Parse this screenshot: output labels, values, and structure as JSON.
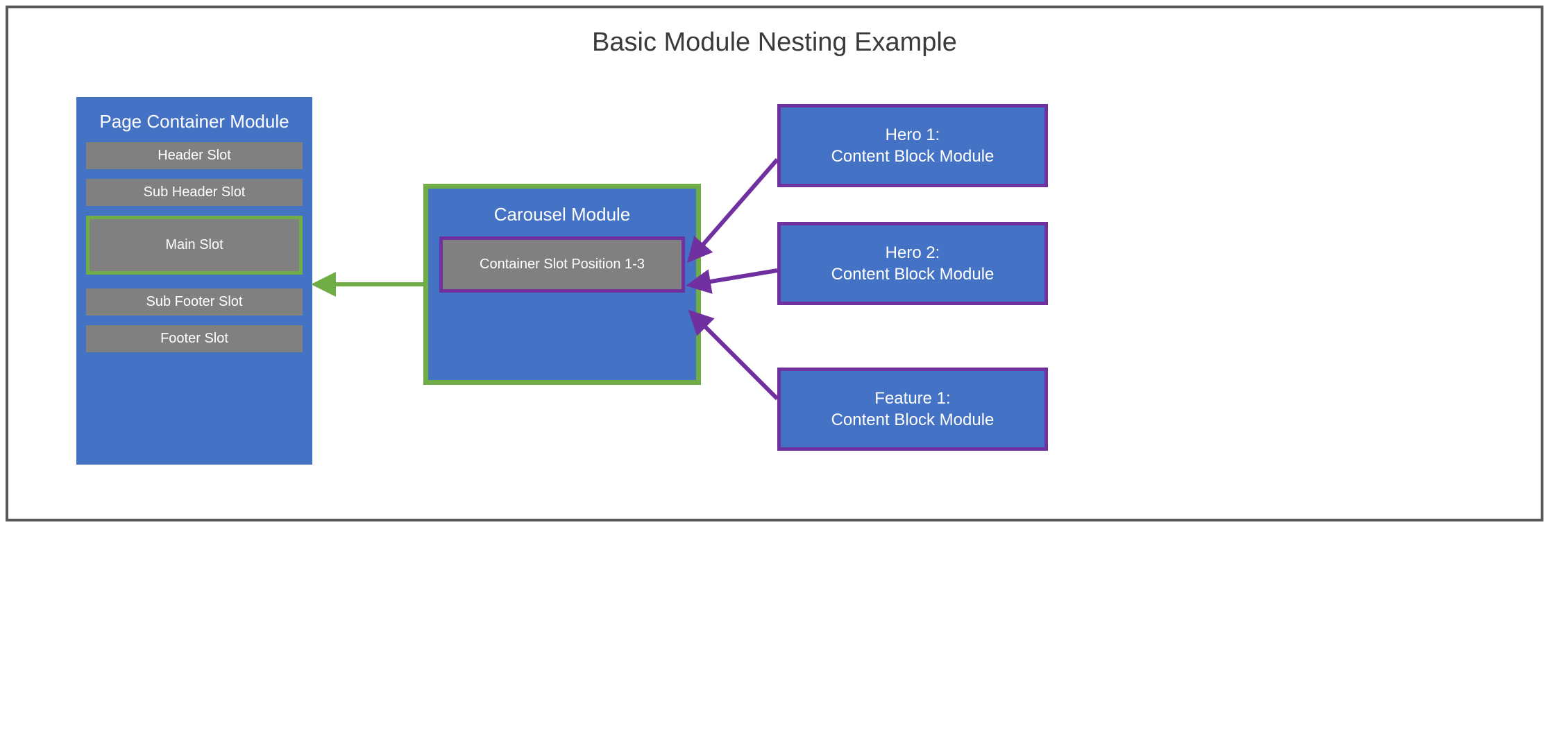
{
  "title": "Basic Module Nesting Example",
  "pageContainer": {
    "title": "Page Container Module",
    "slots": {
      "header": "Header Slot",
      "subHeader": "Sub Header Slot",
      "main": "Main Slot",
      "subFooter": "Sub Footer Slot",
      "footer": "Footer Slot"
    }
  },
  "carousel": {
    "title": "Carousel Module",
    "containerSlot": "Container Slot Position 1-3"
  },
  "blocks": {
    "hero1": {
      "line1": "Hero 1:",
      "line2": "Content Block Module"
    },
    "hero2": {
      "line1": "Hero 2:",
      "line2": "Content Block Module"
    },
    "feature1": {
      "line1": "Feature 1:",
      "line2": "Content Block Module"
    }
  }
}
